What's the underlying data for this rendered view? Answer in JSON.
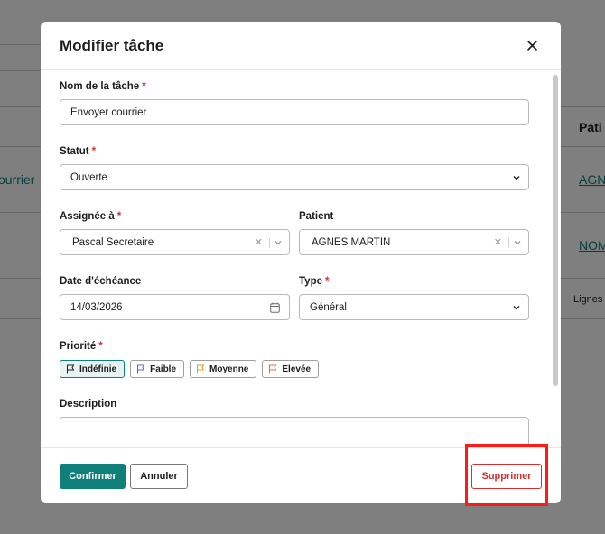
{
  "background": {
    "row_text_left": "ourrier",
    "header_right": "Pati",
    "link1": "AGN",
    "link2": "NOM",
    "footer_right": "Lignes"
  },
  "modal": {
    "title": "Modifier tâche",
    "close_icon": "close-icon",
    "fields": {
      "nom": {
        "label": "Nom de la tâche",
        "required": "*",
        "value": "Envoyer courrier"
      },
      "statut": {
        "label": "Statut",
        "required": "*",
        "value": "Ouverte"
      },
      "assignee": {
        "label": "Assignée à",
        "required": "*",
        "value": "Pascal Secretaire"
      },
      "patient": {
        "label": "Patient",
        "value": "AGNES MARTIN"
      },
      "date": {
        "label": "Date d'échéance",
        "value": "14/03/2026"
      },
      "type": {
        "label": "Type",
        "required": "*",
        "value": "Général"
      },
      "priorite": {
        "label": "Priorité",
        "required": "*",
        "options": [
          {
            "label": "Indéfinie",
            "color": "#1d1d1d",
            "selected": true
          },
          {
            "label": "Faible",
            "color": "#2d7ed6"
          },
          {
            "label": "Moyenne",
            "color": "#e89b2a"
          },
          {
            "label": "Elevée",
            "color": "#e0703a"
          }
        ]
      },
      "description": {
        "label": "Description",
        "value": ""
      }
    },
    "footer": {
      "confirm": "Confirmer",
      "cancel": "Annuler",
      "delete": "Supprimer"
    }
  },
  "colors": {
    "accent": "#0f7f7a",
    "danger": "#d32f2f",
    "highlight": "#ff1a1a"
  }
}
